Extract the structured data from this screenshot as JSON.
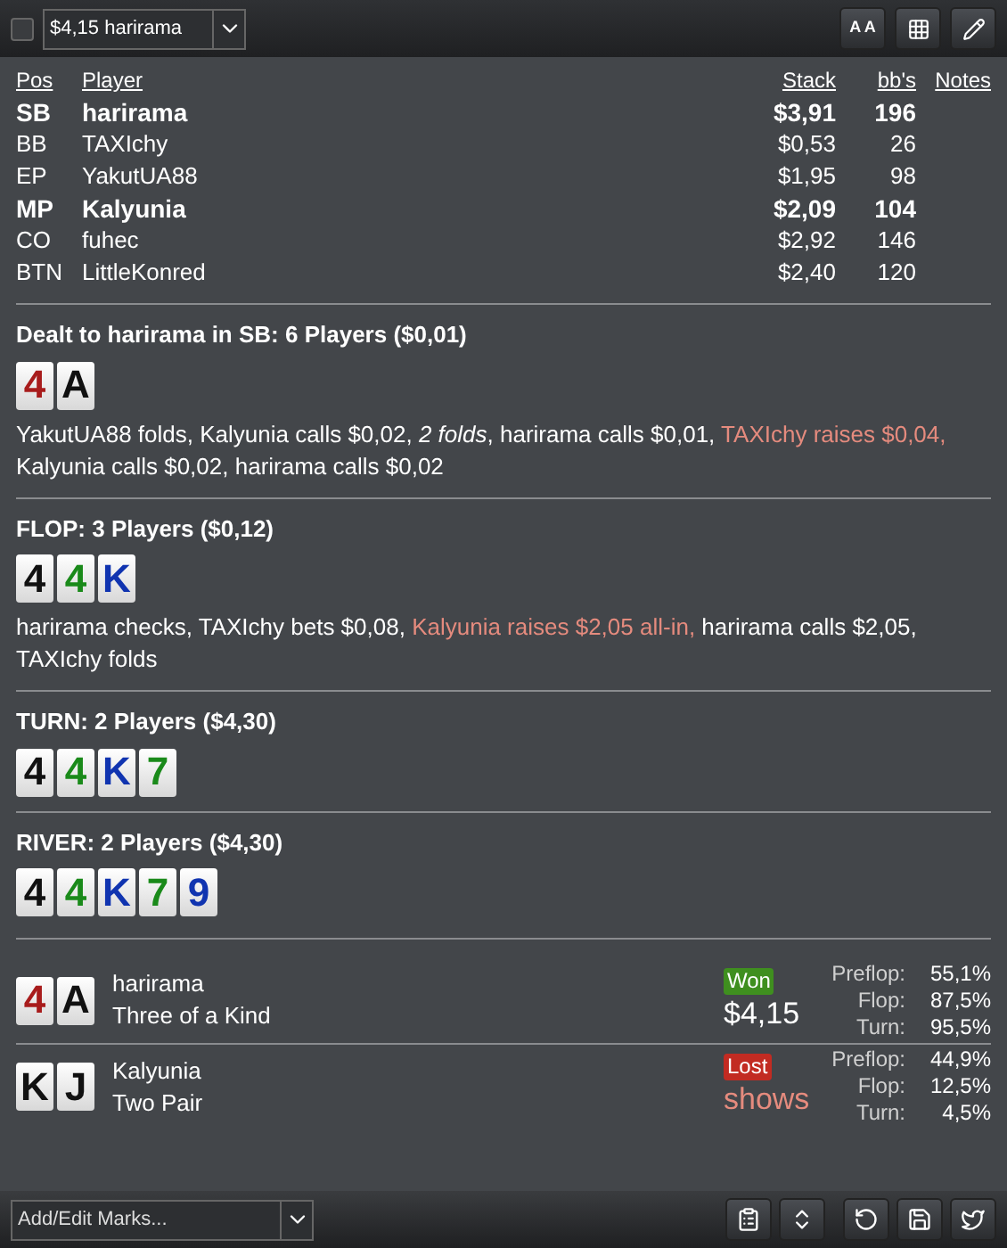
{
  "toolbar": {
    "checked": false,
    "hand_select": "$4,15 harirama",
    "buttons": [
      {
        "kind": "font",
        "label": "A A"
      },
      {
        "kind": "grid"
      },
      {
        "kind": "edit"
      }
    ]
  },
  "players": {
    "columns": [
      "Pos",
      "Player",
      "Stack",
      "bb's",
      "Notes"
    ],
    "rows": [
      {
        "pos": "SB",
        "name": "harirama",
        "stack": "$3,91",
        "bb": "196",
        "bold": true
      },
      {
        "pos": "BB",
        "name": "TAXIchy",
        "stack": "$0,53",
        "bb": "26",
        "bold": false
      },
      {
        "pos": "EP",
        "name": "YakutUA88",
        "stack": "$1,95",
        "bb": "98",
        "bold": false
      },
      {
        "pos": "MP",
        "name": "Kalyunia",
        "stack": "$2,09",
        "bb": "104",
        "bold": true
      },
      {
        "pos": "CO",
        "name": "fuhec",
        "stack": "$2,92",
        "bb": "146",
        "bold": false
      },
      {
        "pos": "BTN",
        "name": "LittleKonred",
        "stack": "$2,40",
        "bb": "120",
        "bold": false
      }
    ]
  },
  "streets": [
    {
      "title": "Dealt to harirama in SB: 6 Players ($0,01)",
      "cards": [
        {
          "rank": "4",
          "color": "#a81c1c"
        },
        {
          "rank": "A",
          "color": "#111111"
        }
      ],
      "actions": [
        {
          "kind": "normal",
          "text": "YakutUA88 folds, Kalyunia calls $0,02, "
        },
        {
          "kind": "italic",
          "text": "2 folds"
        },
        {
          "kind": "normal",
          "text": ", harirama calls $0,01, "
        },
        {
          "kind": "raise",
          "text": "TAXIchy raises $0,04,"
        },
        {
          "kind": "normal",
          "text": " Kalyunia calls $0,02, harirama calls $0,02"
        }
      ]
    },
    {
      "title": "FLOP: 3 Players ($0,12)",
      "cards": [
        {
          "rank": "4",
          "color": "#111111"
        },
        {
          "rank": "4",
          "color": "#1a8a1a"
        },
        {
          "rank": "K",
          "color": "#1034b0"
        }
      ],
      "actions": [
        {
          "kind": "normal",
          "text": "harirama checks, TAXIchy bets $0,08, "
        },
        {
          "kind": "raise",
          "text": "Kalyunia raises $2,05 all-in,"
        },
        {
          "kind": "normal",
          "text": " harirama calls $2,05, TAXIchy folds"
        }
      ]
    },
    {
      "title": "TURN: 2 Players ($4,30)",
      "cards": [
        {
          "rank": "4",
          "color": "#111111"
        },
        {
          "rank": "4",
          "color": "#1a8a1a"
        },
        {
          "rank": "K",
          "color": "#1034b0"
        },
        {
          "rank": "7",
          "color": "#1a8a1a"
        }
      ]
    },
    {
      "title": "RIVER: 2 Players ($4,30)",
      "cards": [
        {
          "rank": "4",
          "color": "#111111"
        },
        {
          "rank": "4",
          "color": "#1a8a1a"
        },
        {
          "rank": "K",
          "color": "#1034b0"
        },
        {
          "rank": "7",
          "color": "#1a8a1a"
        },
        {
          "rank": "9",
          "color": "#1034b0"
        }
      ]
    }
  ],
  "results": [
    {
      "cards": [
        {
          "rank": "4",
          "color": "#a81c1c"
        },
        {
          "rank": "A",
          "color": "#111111"
        }
      ],
      "name": "harirama",
      "hand": "Three of a Kind",
      "kind": "won",
      "badge": "Won",
      "amount": "$4,15",
      "equity": [
        {
          "label": "Preflop:",
          "value": "55,1%"
        },
        {
          "label": "Flop:",
          "value": "87,5%"
        },
        {
          "label": "Turn:",
          "value": "95,5%"
        }
      ]
    },
    {
      "cards": [
        {
          "rank": "K",
          "color": "#111111"
        },
        {
          "rank": "J",
          "color": "#111111"
        }
      ],
      "name": "Kalyunia",
      "hand": "Two Pair",
      "kind": "lost",
      "badge": "Lost",
      "amount": "shows",
      "equity": [
        {
          "label": "Preflop:",
          "value": "44,9%"
        },
        {
          "label": "Flop:",
          "value": "12,5%"
        },
        {
          "label": "Turn:",
          "value": "4,5%"
        }
      ]
    }
  ],
  "footer": {
    "marks_placeholder": "Add/Edit Marks..."
  }
}
